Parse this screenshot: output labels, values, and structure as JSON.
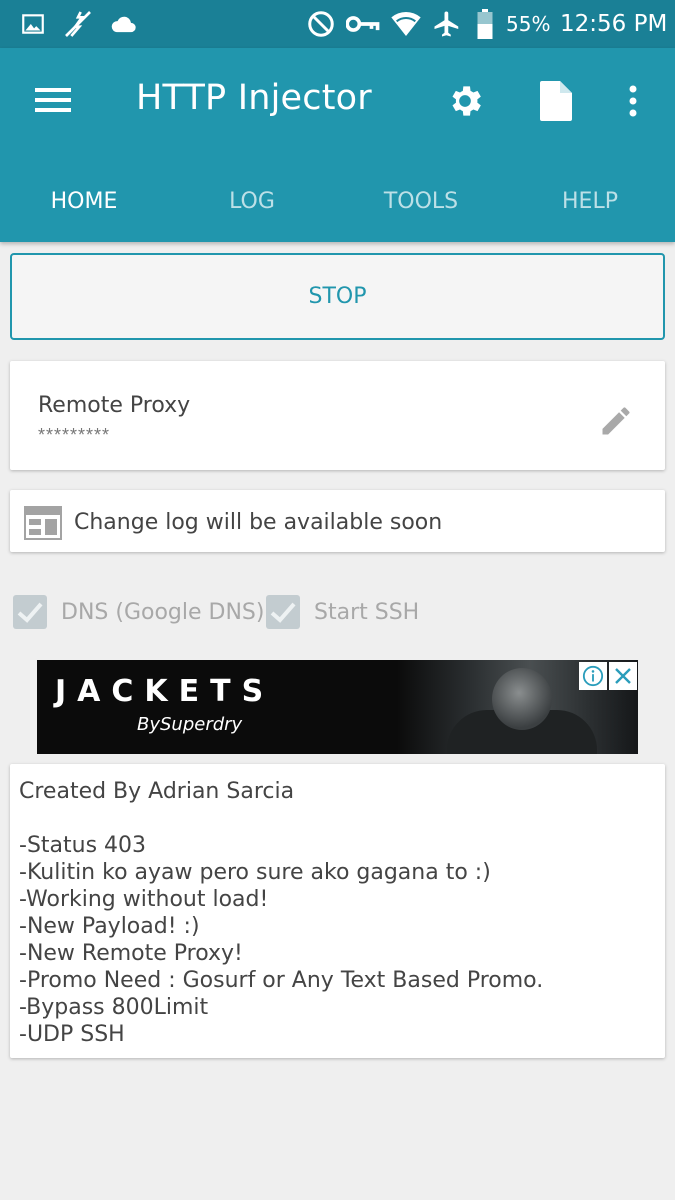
{
  "status_bar": {
    "icons": [
      "image-icon",
      "no-signal-plug-icon",
      "cloud-icon",
      "do-not-disturb-icon",
      "vpn-key-icon",
      "wifi-icon",
      "airplane-mode-icon",
      "battery-icon"
    ],
    "battery": "55%",
    "time": "12:56 PM"
  },
  "app_bar": {
    "title": "HTTP Injector",
    "actions": [
      "settings-icon",
      "file-icon",
      "overflow-menu-icon"
    ],
    "tabs": [
      {
        "label": "HOME",
        "active": true
      },
      {
        "label": "LOG",
        "active": false
      },
      {
        "label": "TOOLS",
        "active": false
      },
      {
        "label": "HELP",
        "active": false
      }
    ],
    "color": "#2196ad"
  },
  "main": {
    "stop_label": "STOP",
    "remote_proxy": {
      "title": "Remote Proxy",
      "value": "*********"
    },
    "change_log_text": "Change log will be available soon",
    "options": [
      {
        "label": "DNS (Google DNS)",
        "checked": true
      },
      {
        "label": "Start SSH",
        "checked": true
      }
    ]
  },
  "ad": {
    "title": "JACKETS",
    "subtitle": "BySuperdry"
  },
  "notes": [
    "Created By Adrian Sarcia",
    "",
    "-Status 403",
    "-Kulitin ko ayaw pero sure ako gagana to :)",
    "-Working without load!",
    "-New Payload! :)",
    "-New Remote Proxy!",
    "-Promo Need : Gosurf or Any Text Based Promo.",
    "-Bypass 800Limit",
    "-UDP SSH"
  ]
}
